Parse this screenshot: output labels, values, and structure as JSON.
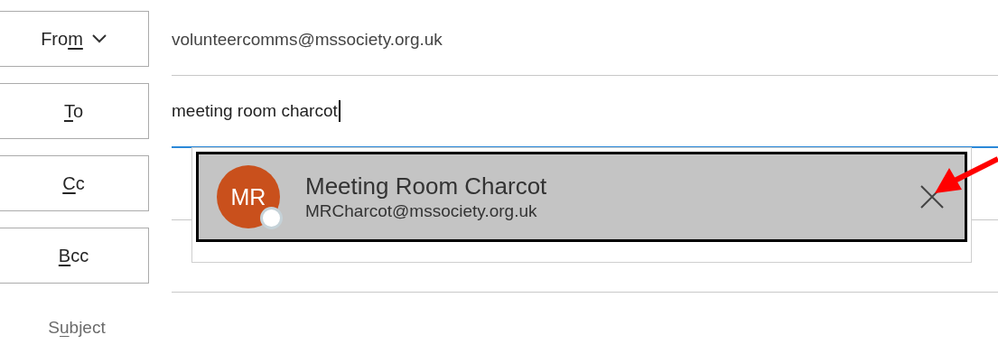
{
  "fields": [
    {
      "label": [
        {
          "text": "Fro",
          "underlined": false
        },
        {
          "text": "m",
          "underlined": true
        }
      ],
      "dropdown": true,
      "value": "volunteercomms@mssociety.org.uk",
      "focused": false
    },
    {
      "label": [
        {
          "text": "T",
          "underlined": true
        },
        {
          "text": "o",
          "underlined": false
        }
      ],
      "dropdown": false,
      "value": "meeting room charcot",
      "focused": true
    },
    {
      "label": [
        {
          "text": "C",
          "underlined": true
        },
        {
          "text": "c",
          "underlined": false
        }
      ],
      "dropdown": false,
      "focused": false
    },
    {
      "label": [
        {
          "text": "B",
          "underlined": true
        },
        {
          "text": "cc",
          "underlined": false
        }
      ],
      "dropdown": false,
      "focused": false
    }
  ],
  "subject": {
    "label": [
      {
        "text": "S",
        "underlined": false
      },
      {
        "text": "u",
        "underlined": true
      },
      {
        "text": "bject",
        "underlined": false
      }
    ]
  },
  "suggestions": [
    {
      "initials": "MR",
      "name": "Meeting Room Charcot",
      "email": "MRCharcot@mssociety.org.uk",
      "selected": true
    }
  ]
}
